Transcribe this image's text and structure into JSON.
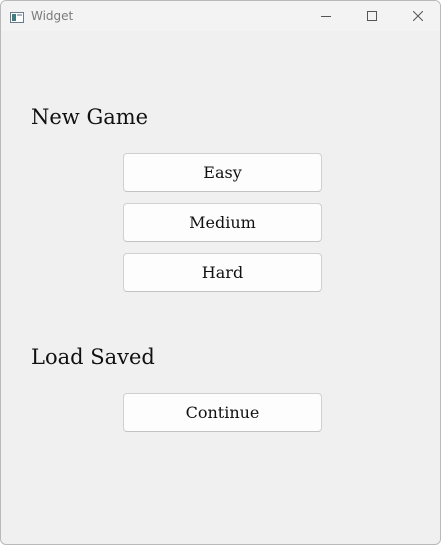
{
  "window": {
    "title": "Widget"
  },
  "icons": {
    "app": "app-window-icon",
    "minimize": "minimize-icon",
    "maximize": "maximize-icon",
    "close": "close-icon"
  },
  "new_game": {
    "heading": "New Game",
    "buttons": [
      "Easy",
      "Medium",
      "Hard"
    ]
  },
  "load_saved": {
    "heading": "Load Saved",
    "buttons": [
      "Continue"
    ]
  }
}
